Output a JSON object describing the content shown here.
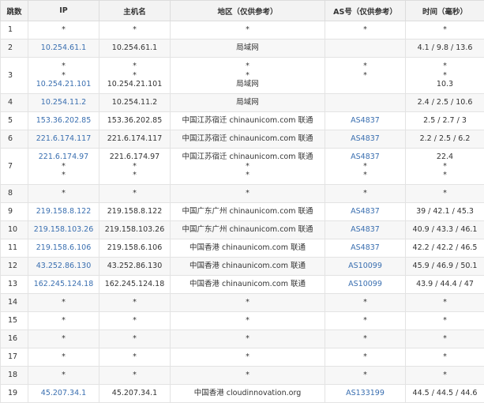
{
  "headers": [
    "跳数",
    "IP",
    "主机名",
    "地区（仅供参考）",
    "AS号（仅供参考）",
    "时间（毫秒）"
  ],
  "rows": [
    {
      "hop": "1",
      "ip": [
        "*"
      ],
      "host": [
        "*"
      ],
      "region": [
        "*"
      ],
      "as": [
        "*"
      ],
      "time": [
        "*"
      ]
    },
    {
      "hop": "2",
      "ip": [
        "10.254.61.1"
      ],
      "host": [
        "10.254.61.1"
      ],
      "region": [
        "局域网"
      ],
      "as": [
        ""
      ],
      "time": [
        "4.1 / 9.8 / 13.6"
      ]
    },
    {
      "hop": "3",
      "ip": [
        "*",
        "*",
        "10.254.21.101"
      ],
      "host": [
        "*",
        "*",
        "10.254.21.101"
      ],
      "region": [
        "*",
        "*",
        "局域网"
      ],
      "as": [
        "*",
        "*",
        ""
      ],
      "time": [
        "*",
        "*",
        "10.3"
      ]
    },
    {
      "hop": "4",
      "ip": [
        "10.254.11.2"
      ],
      "host": [
        "10.254.11.2"
      ],
      "region": [
        "局域网"
      ],
      "as": [
        ""
      ],
      "time": [
        "2.4 / 2.5 / 10.6"
      ]
    },
    {
      "hop": "5",
      "ip": [
        "153.36.202.85"
      ],
      "host": [
        "153.36.202.85"
      ],
      "region": [
        "中国江苏宿迁 chinaunicom.com 联通"
      ],
      "as": [
        "AS4837"
      ],
      "time": [
        "2.5 / 2.7 / 3"
      ]
    },
    {
      "hop": "6",
      "ip": [
        "221.6.174.117"
      ],
      "host": [
        "221.6.174.117"
      ],
      "region": [
        "中国江苏宿迁 chinaunicom.com 联通"
      ],
      "as": [
        "AS4837"
      ],
      "time": [
        "2.2 / 2.5 / 6.2"
      ]
    },
    {
      "hop": "7",
      "ip": [
        "221.6.174.97",
        "*",
        "*"
      ],
      "host": [
        "221.6.174.97",
        "*",
        "*"
      ],
      "region": [
        "中国江苏宿迁 chinaunicom.com 联通",
        "*",
        "*"
      ],
      "as": [
        "AS4837",
        "*",
        "*"
      ],
      "time": [
        "22.4",
        "*",
        "*"
      ]
    },
    {
      "hop": "8",
      "ip": [
        "*"
      ],
      "host": [
        "*"
      ],
      "region": [
        "*"
      ],
      "as": [
        "*"
      ],
      "time": [
        "*"
      ]
    },
    {
      "hop": "9",
      "ip": [
        "219.158.8.122"
      ],
      "host": [
        "219.158.8.122"
      ],
      "region": [
        "中国广东广州 chinaunicom.com 联通"
      ],
      "as": [
        "AS4837"
      ],
      "time": [
        "39 / 42.1 / 45.3"
      ]
    },
    {
      "hop": "10",
      "ip": [
        "219.158.103.26"
      ],
      "host": [
        "219.158.103.26"
      ],
      "region": [
        "中国广东广州 chinaunicom.com 联通"
      ],
      "as": [
        "AS4837"
      ],
      "time": [
        "40.9 / 43.3 / 46.1"
      ]
    },
    {
      "hop": "11",
      "ip": [
        "219.158.6.106"
      ],
      "host": [
        "219.158.6.106"
      ],
      "region": [
        "中国香港 chinaunicom.com 联通"
      ],
      "as": [
        "AS4837"
      ],
      "time": [
        "42.2 / 42.2 / 46.5"
      ]
    },
    {
      "hop": "12",
      "ip": [
        "43.252.86.130"
      ],
      "host": [
        "43.252.86.130"
      ],
      "region": [
        "中国香港 chinaunicom.com 联通"
      ],
      "as": [
        "AS10099"
      ],
      "time": [
        "45.9 / 46.9 / 50.1"
      ]
    },
    {
      "hop": "13",
      "ip": [
        "162.245.124.18"
      ],
      "host": [
        "162.245.124.18"
      ],
      "region": [
        "中国香港 chinaunicom.com 联通"
      ],
      "as": [
        "AS10099"
      ],
      "time": [
        "43.9 / 44.4 / 47"
      ]
    },
    {
      "hop": "14",
      "ip": [
        "*"
      ],
      "host": [
        "*"
      ],
      "region": [
        "*"
      ],
      "as": [
        "*"
      ],
      "time": [
        "*"
      ]
    },
    {
      "hop": "15",
      "ip": [
        "*"
      ],
      "host": [
        "*"
      ],
      "region": [
        "*"
      ],
      "as": [
        "*"
      ],
      "time": [
        "*"
      ]
    },
    {
      "hop": "16",
      "ip": [
        "*"
      ],
      "host": [
        "*"
      ],
      "region": [
        "*"
      ],
      "as": [
        "*"
      ],
      "time": [
        "*"
      ]
    },
    {
      "hop": "17",
      "ip": [
        "*"
      ],
      "host": [
        "*"
      ],
      "region": [
        "*"
      ],
      "as": [
        "*"
      ],
      "time": [
        "*"
      ]
    },
    {
      "hop": "18",
      "ip": [
        "*"
      ],
      "host": [
        "*"
      ],
      "region": [
        "*"
      ],
      "as": [
        "*"
      ],
      "time": [
        "*"
      ]
    },
    {
      "hop": "19",
      "ip": [
        "45.207.34.1"
      ],
      "host": [
        "45.207.34.1"
      ],
      "region": [
        "中国香港 cloudinnovation.org"
      ],
      "as": [
        "AS133199"
      ],
      "time": [
        "44.5 / 44.5 / 44.6"
      ]
    }
  ],
  "colors": {
    "link": "#3a6fb0",
    "header_bg": "#f3f3f3",
    "stripe_bg": "#f7f7f7",
    "border": "#e3e3e3"
  }
}
